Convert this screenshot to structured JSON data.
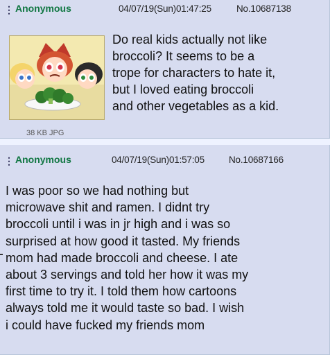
{
  "post1": {
    "dots": "⋮",
    "name": "Anonymous",
    "datetime": "04/07/19(Sun)01:47:25",
    "post_no": "No.10687138",
    "file_info": "38 KB JPG",
    "body": "Do real kids actually not like\nbroccoli? It seems to be a\ntrope for characters to hate it,\nbut I loved eating broccoli\nand other vegetables as a kid."
  },
  "post2": {
    "dots": "⋮",
    "name": "Anonymous",
    "datetime": "04/07/19(Sun)01:57:05",
    "post_no": "No.10687166",
    "body": "I was poor so we had nothing but\nmicrowave shit and ramen. I didnt try\nbroccoli until i was in jr high and i was so\nsurprised at how good it tasted. My friends\nmom had made broccoli and cheese. I ate\nabout 3 servings and told her how it was my\nfirst time to try it. I told them how cartoons\nalways told me it would taste so bad. I wish\ni could have fucked my friends mom"
  },
  "colors": {
    "post_bg": "#d7dcf0",
    "page_bg": "#eef2ff",
    "name_green": "#117743"
  }
}
